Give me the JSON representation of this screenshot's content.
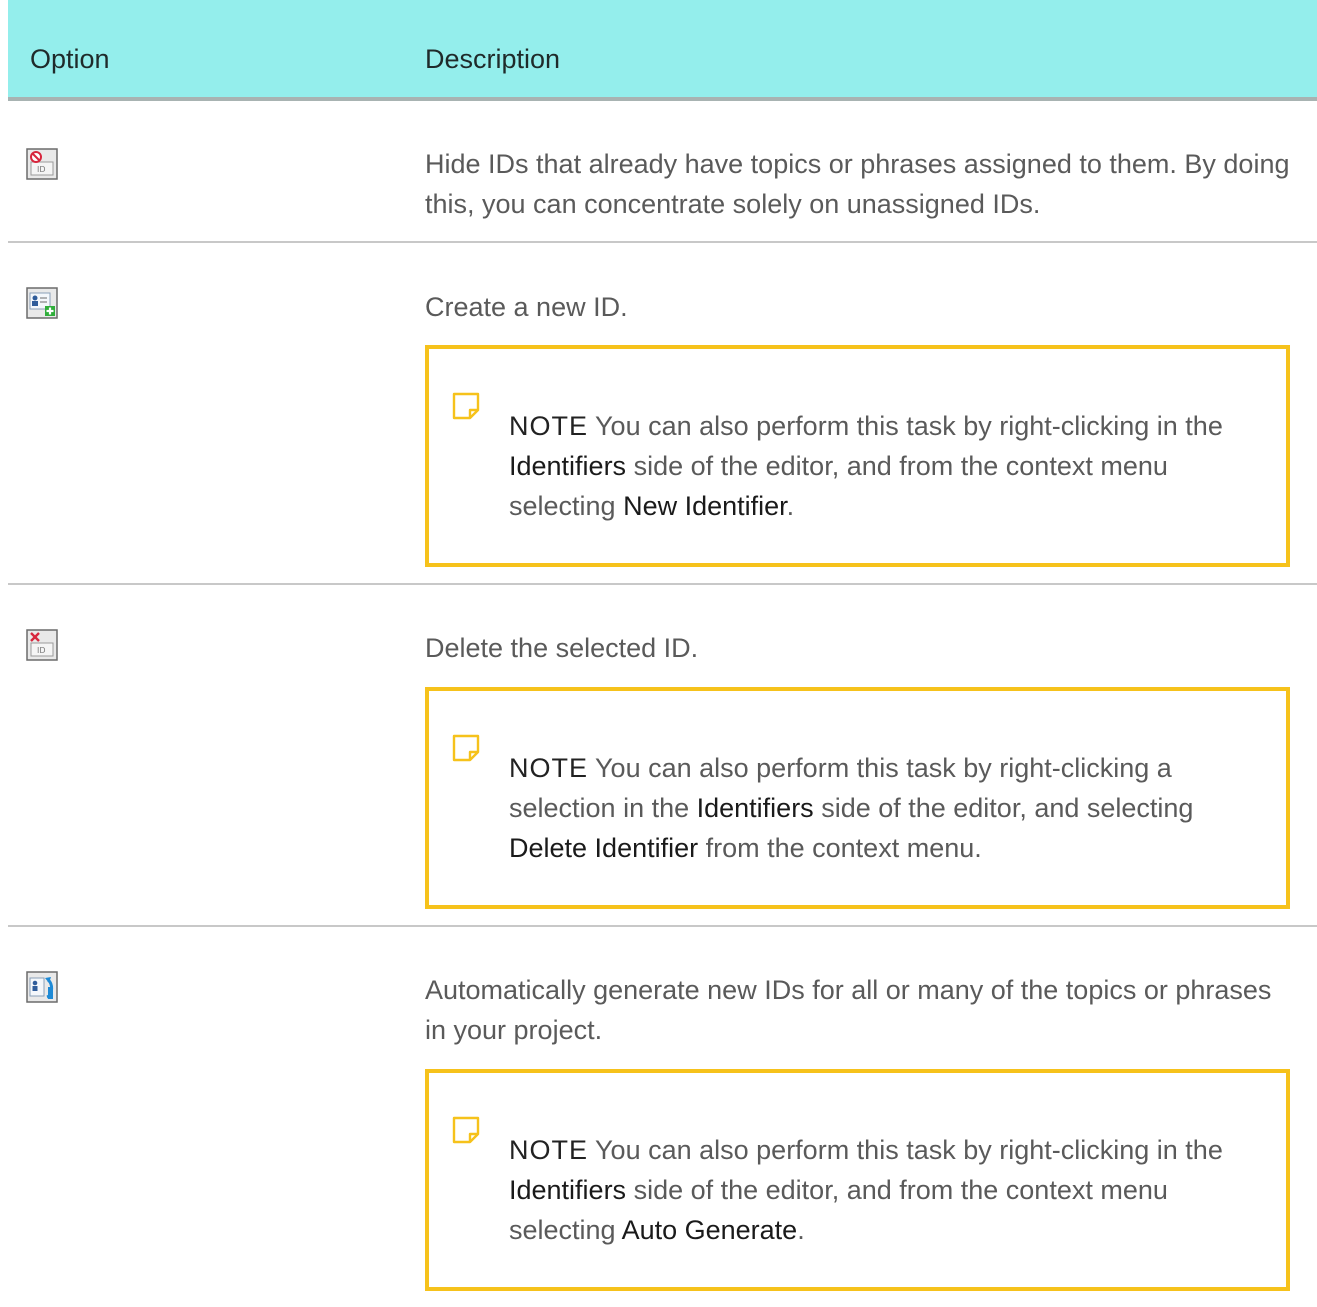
{
  "header": {
    "option_label": "Option",
    "description_label": "Description"
  },
  "colors": {
    "header_bg": "#94eeec",
    "note_border": "#f6c21b",
    "divider": "#c8c8c8"
  },
  "rows": [
    {
      "icon": "hide-assigned-ids-icon",
      "description": "Hide IDs that already have topics or phrases assigned to them. By doing this, you can concentrate solely on unassigned IDs."
    },
    {
      "icon": "new-id-icon",
      "description": "Create a new ID.",
      "note": {
        "label": "NOTE",
        "part1": " You can also perform this task by right-clicking in the ",
        "em1": "Identifiers",
        "part2": " side of the editor, and from the context menu selecting ",
        "em2": "New Identifier",
        "part3": "."
      }
    },
    {
      "icon": "delete-id-icon",
      "description": "Delete the selected ID.",
      "note": {
        "label": "NOTE",
        "part1": " You can also perform this task by right-clicking a selection in the ",
        "em1": "Identifiers",
        "part2": " side of the editor, and selecting ",
        "em2": "Delete Identifier",
        "part3": " from the context menu."
      }
    },
    {
      "icon": "auto-generate-ids-icon",
      "description": "Automatically generate new IDs for all or many of the topics or phrases in your project.",
      "note": {
        "label": "NOTE",
        "part1": " You can also perform this task by right-clicking in the ",
        "em1": "Identifiers",
        "part2": " side of the editor, and from the context menu selecting ",
        "em2": "Auto Generate",
        "part3": "."
      }
    }
  ]
}
